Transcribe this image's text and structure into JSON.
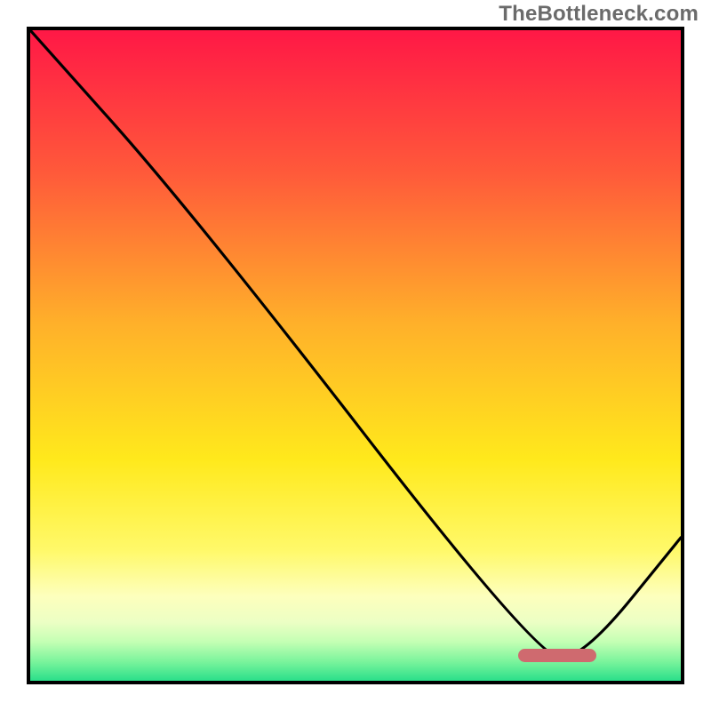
{
  "watermark": "TheBottleneck.com",
  "chart_data": {
    "type": "line",
    "title": "",
    "xlabel": "",
    "ylabel": "",
    "xlim": [
      0,
      100
    ],
    "ylim": [
      0,
      100
    ],
    "grid": false,
    "legend": false,
    "series": [
      {
        "name": "curve",
        "x": [
          0,
          25,
          78,
          85,
          100
        ],
        "values": [
          100,
          72,
          3.5,
          3.5,
          22
        ]
      }
    ],
    "marker": {
      "x_start": 75,
      "x_end": 87,
      "y": 4,
      "color": "#cf6a6f"
    },
    "gradient_stops": [
      {
        "offset": 0.0,
        "color": "#ff1846"
      },
      {
        "offset": 0.22,
        "color": "#ff5a3a"
      },
      {
        "offset": 0.45,
        "color": "#ffb02a"
      },
      {
        "offset": 0.66,
        "color": "#ffe91c"
      },
      {
        "offset": 0.8,
        "color": "#fff96a"
      },
      {
        "offset": 0.87,
        "color": "#fdffbd"
      },
      {
        "offset": 0.91,
        "color": "#ecffc4"
      },
      {
        "offset": 0.94,
        "color": "#c4ffb4"
      },
      {
        "offset": 0.97,
        "color": "#7cf49c"
      },
      {
        "offset": 1.0,
        "color": "#2adf8a"
      }
    ]
  }
}
